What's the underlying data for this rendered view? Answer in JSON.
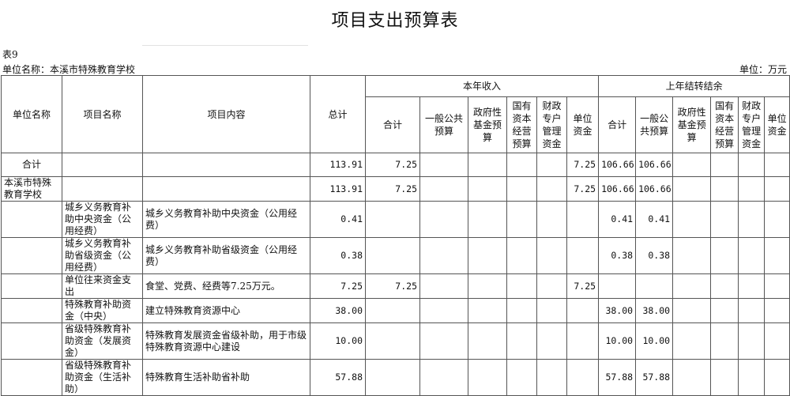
{
  "title": "项目支出预算表",
  "table_no": "表9",
  "unit_name": "单位名称：本溪市特殊教育学校",
  "unit_label": "单位：万元",
  "headers": {
    "unit": "单位名称",
    "project": "项目名称",
    "content": "项目内容",
    "total": "总计",
    "this_year": "本年收入",
    "last_year": "上年结转结余",
    "ty_cols": [
      "合计",
      "一般公共预算",
      "政府性基金预算",
      "国有资本经营预算",
      "财政专户管理资金",
      "单位资金"
    ],
    "ly_cols": [
      "合计",
      "一般公共预算",
      "政府性基金预算",
      "国有资本经营预算",
      "财政专户管理资金",
      "单位资金"
    ]
  },
  "rows": [
    {
      "unit": "合计",
      "project": "",
      "content": "",
      "total": "113.91",
      "ty_total": "7.25",
      "ty_general": "",
      "ty_fund": "",
      "ty_state": "",
      "ty_special": "",
      "ty_unit": "7.25",
      "ly_total": "106.66",
      "ly_general": "106.66",
      "ly_fund": "",
      "ly_state": "",
      "ly_special": "",
      "ly_unit": ""
    },
    {
      "unit": "本溪市特殊教育学校",
      "project": "",
      "content": "",
      "total": "113.91",
      "ty_total": "7.25",
      "ty_general": "",
      "ty_fund": "",
      "ty_state": "",
      "ty_special": "",
      "ty_unit": "7.25",
      "ly_total": "106.66",
      "ly_general": "106.66",
      "ly_fund": "",
      "ly_state": "",
      "ly_special": "",
      "ly_unit": ""
    },
    {
      "unit": "",
      "project": "城乡义务教育补助中央资金（公用经费）",
      "content": "城乡义务教育补助中央资金（公用经费）",
      "total": "0.41",
      "ty_total": "",
      "ty_general": "",
      "ty_fund": "",
      "ty_state": "",
      "ty_special": "",
      "ty_unit": "",
      "ly_total": "0.41",
      "ly_general": "0.41",
      "ly_fund": "",
      "ly_state": "",
      "ly_special": "",
      "ly_unit": ""
    },
    {
      "unit": "",
      "project": "城乡义务教育补助省级资金（公用经费）",
      "content": "城乡义务教育补助省级资金（公用经费）",
      "total": "0.38",
      "ty_total": "",
      "ty_general": "",
      "ty_fund": "",
      "ty_state": "",
      "ty_special": "",
      "ty_unit": "",
      "ly_total": "0.38",
      "ly_general": "0.38",
      "ly_fund": "",
      "ly_state": "",
      "ly_special": "",
      "ly_unit": ""
    },
    {
      "unit": "",
      "project": "单位往来资金支出",
      "content": "食堂、党费、经费等7.25万元。",
      "total": "7.25",
      "ty_total": "7.25",
      "ty_general": "",
      "ty_fund": "",
      "ty_state": "",
      "ty_special": "",
      "ty_unit": "7.25",
      "ly_total": "",
      "ly_general": "",
      "ly_fund": "",
      "ly_state": "",
      "ly_special": "",
      "ly_unit": ""
    },
    {
      "unit": "",
      "project": "特殊教育补助资金（中央）",
      "content": "建立特殊教育资源中心",
      "total": "38.00",
      "ty_total": "",
      "ty_general": "",
      "ty_fund": "",
      "ty_state": "",
      "ty_special": "",
      "ty_unit": "",
      "ly_total": "38.00",
      "ly_general": "38.00",
      "ly_fund": "",
      "ly_state": "",
      "ly_special": "",
      "ly_unit": ""
    },
    {
      "unit": "",
      "project": "省级特殊教育补助资金（发展资金）",
      "content": "特殊教育发展资金省级补助，用于市级特殊教育资源中心建设",
      "total": "10.00",
      "ty_total": "",
      "ty_general": "",
      "ty_fund": "",
      "ty_state": "",
      "ty_special": "",
      "ty_unit": "",
      "ly_total": "10.00",
      "ly_general": "10.00",
      "ly_fund": "",
      "ly_state": "",
      "ly_special": "",
      "ly_unit": ""
    },
    {
      "unit": "",
      "project": "省级特殊教育补助资金（生活补助）",
      "content": "特殊教育生活补助省补助",
      "total": "57.88",
      "ty_total": "",
      "ty_general": "",
      "ty_fund": "",
      "ty_state": "",
      "ty_special": "",
      "ty_unit": "",
      "ly_total": "57.88",
      "ly_general": "57.88",
      "ly_fund": "",
      "ly_state": "",
      "ly_special": "",
      "ly_unit": ""
    }
  ]
}
